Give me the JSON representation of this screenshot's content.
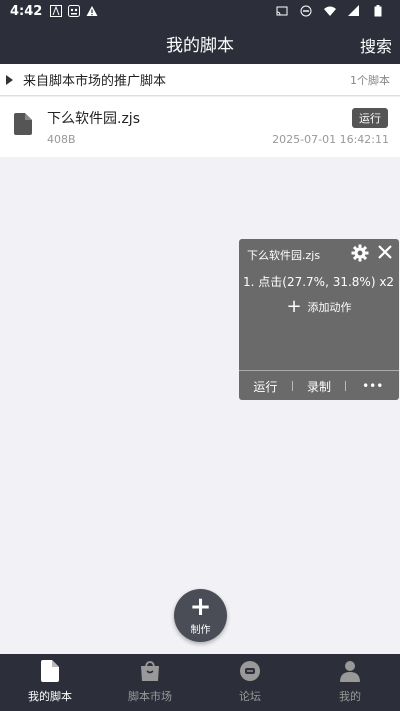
{
  "status_bar": {
    "time": "4:42"
  },
  "header": {
    "title": "我的脚本",
    "search_label": "搜索"
  },
  "section": {
    "title": "来自脚本市场的推广脚本",
    "count": "1个脚本"
  },
  "script": {
    "name": "下么软件园.zjs",
    "size": "408B",
    "date": "2025-07-01 16:42:11",
    "run_label": "运行"
  },
  "panel": {
    "title": "下么软件园.zjs",
    "action": "1. 点击(27.7%, 31.8%) x2",
    "add_label": "添加动作",
    "run_label": "运行",
    "record_label": "录制",
    "more_label": "•••"
  },
  "fab": {
    "label": "制作"
  },
  "nav": {
    "items": [
      {
        "label": "我的脚本",
        "icon": "file-icon"
      },
      {
        "label": "脚本市场",
        "icon": "bag-icon"
      },
      {
        "label": "论坛",
        "icon": "chat-icon"
      },
      {
        "label": "我的",
        "icon": "person-icon"
      }
    ]
  },
  "colors": {
    "bar": "#2c2f3a",
    "panel": "#606060",
    "background": "#f2f2f6"
  }
}
